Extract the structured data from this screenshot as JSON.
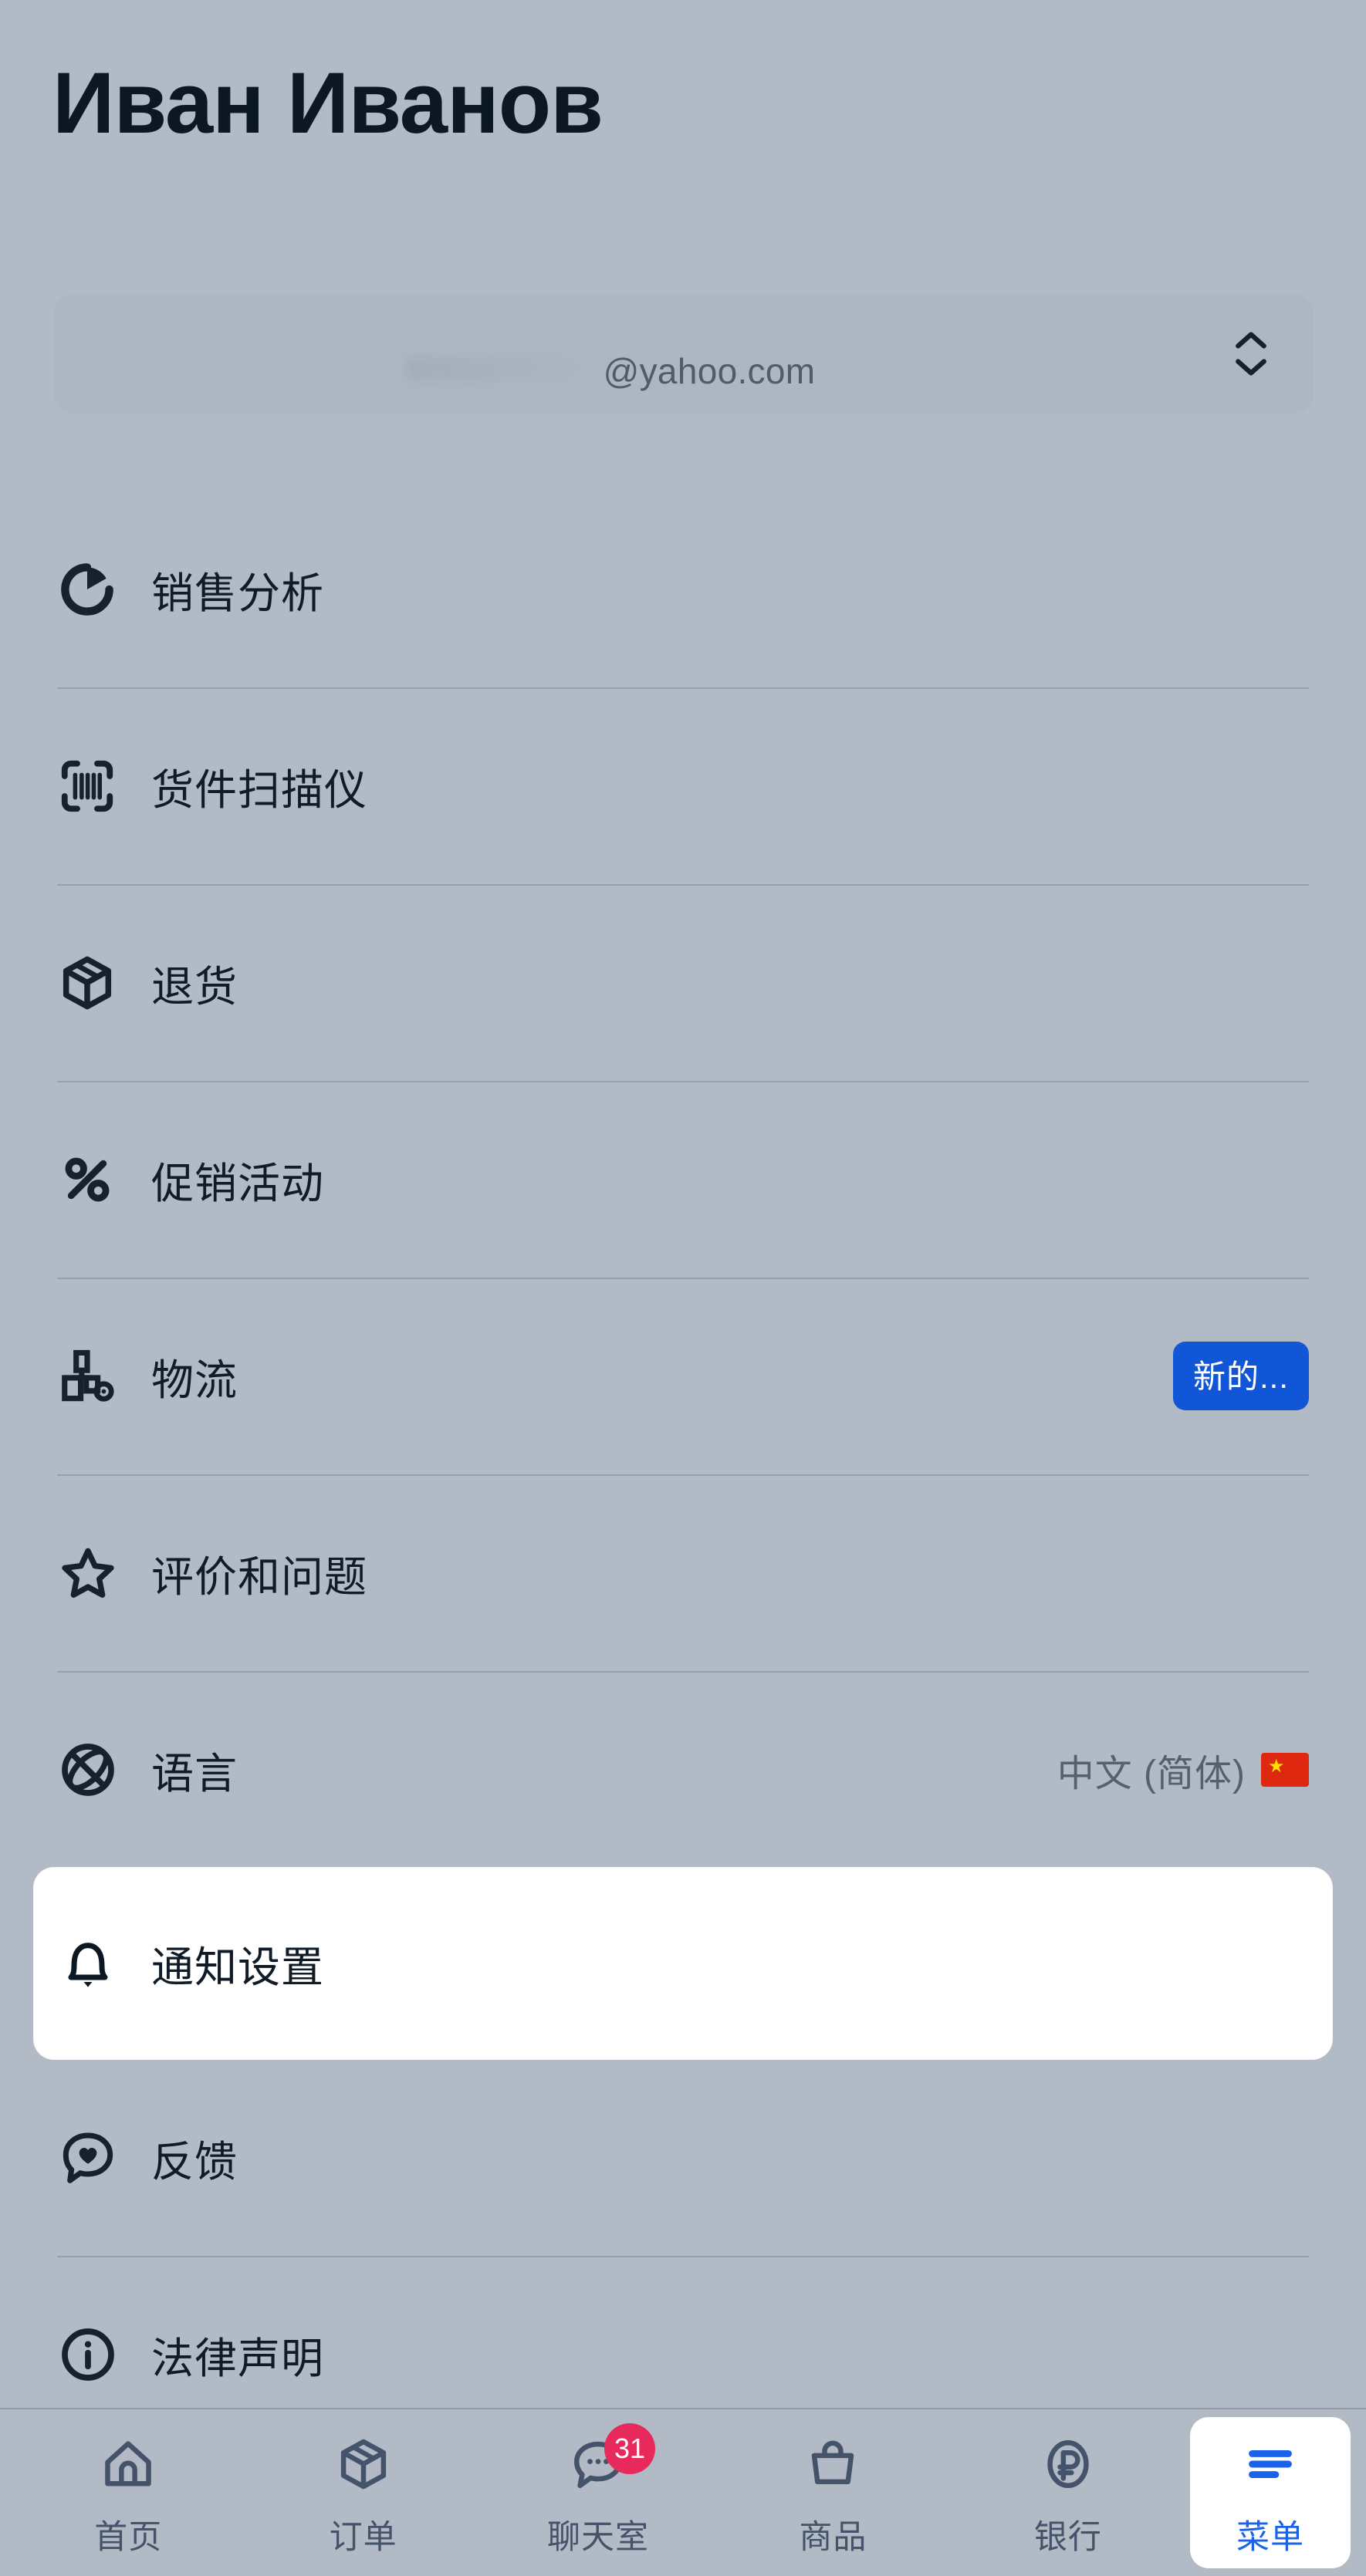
{
  "header": {
    "title": "Иван Иванов"
  },
  "account": {
    "email_domain": "@yahoo.com",
    "selector_icon": "chevron-up-down-icon"
  },
  "menu": {
    "items": [
      {
        "label": "销售分析",
        "icon": "sales-analytics-icon",
        "value": "",
        "badge": ""
      },
      {
        "label": "货件扫描仪",
        "icon": "barcode-scanner-icon",
        "value": "",
        "badge": ""
      },
      {
        "label": "退货",
        "icon": "package-box-icon",
        "value": "",
        "badge": ""
      },
      {
        "label": "促销活动",
        "icon": "percent-icon",
        "value": "",
        "badge": ""
      },
      {
        "label": "物流",
        "icon": "logistics-icon",
        "value": "",
        "badge": "新的..."
      },
      {
        "label": "评价和问题",
        "icon": "star-icon",
        "value": "",
        "badge": ""
      },
      {
        "label": "语言",
        "icon": "globe-icon",
        "value": "中文 (简体)",
        "badge": ""
      },
      {
        "label": "通知设置",
        "icon": "bell-icon",
        "value": "",
        "badge": ""
      },
      {
        "label": "反馈",
        "icon": "feedback-heart-icon",
        "value": "",
        "badge": ""
      },
      {
        "label": "法律声明",
        "icon": "info-circle-icon",
        "value": "",
        "badge": ""
      }
    ]
  },
  "bottom_nav": {
    "items": [
      {
        "label": "首页",
        "icon": "home-icon",
        "badge": ""
      },
      {
        "label": "订单",
        "icon": "orders-box-icon",
        "badge": ""
      },
      {
        "label": "聊天室",
        "icon": "chat-bubble-icon",
        "badge": "31"
      },
      {
        "label": "商品",
        "icon": "shopping-bag-icon",
        "badge": ""
      },
      {
        "label": "银行",
        "icon": "ruble-coin-icon",
        "badge": ""
      },
      {
        "label": "菜单",
        "icon": "hamburger-menu-icon",
        "badge": ""
      }
    ]
  },
  "colors": {
    "background": "#b2bac5",
    "text_primary": "#101b28",
    "text_secondary": "#54616f",
    "accent_blue": "#1056d6",
    "active_blue": "#1a62e8",
    "badge_red": "#e8295b",
    "flag_red": "#de2910",
    "card_white": "#ffffff"
  }
}
